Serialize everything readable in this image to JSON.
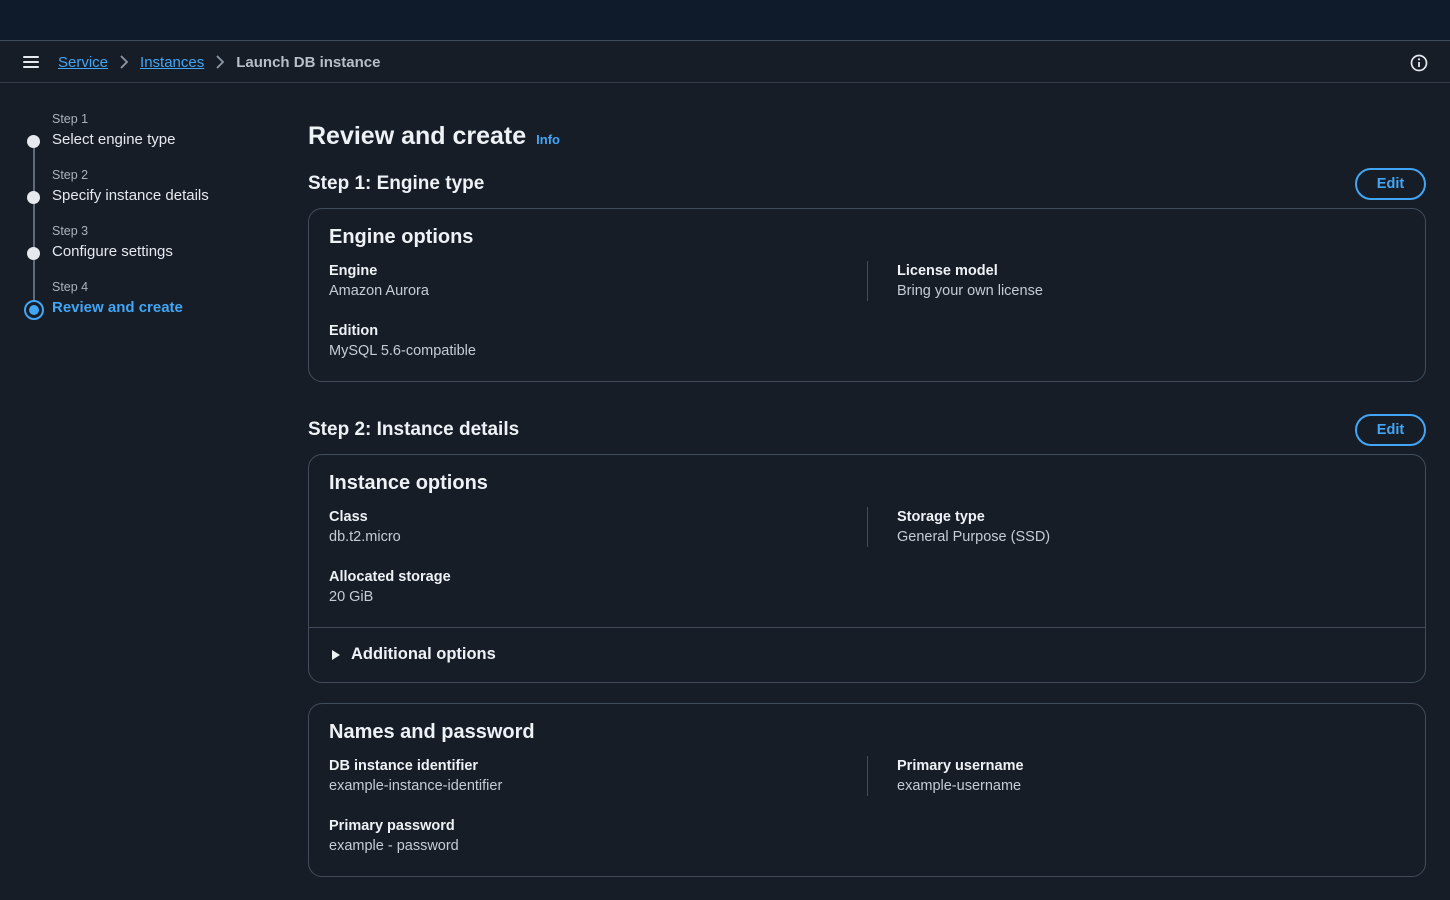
{
  "breadcrumb": {
    "items": [
      "Service",
      "Instances"
    ],
    "current": "Launch DB instance"
  },
  "steps": [
    {
      "num": "Step 1",
      "title": "Select engine type"
    },
    {
      "num": "Step 2",
      "title": "Specify instance details"
    },
    {
      "num": "Step 3",
      "title": "Configure settings"
    },
    {
      "num": "Step 4",
      "title": "Review and create"
    }
  ],
  "page": {
    "title": "Review and create",
    "info_label": "Info"
  },
  "section1": {
    "heading": "Step 1: Engine type",
    "edit_label": "Edit",
    "card": {
      "title": "Engine options",
      "engine": {
        "label": "Engine",
        "value": "Amazon Aurora"
      },
      "license": {
        "label": "License model",
        "value": "Bring your own license"
      },
      "edition": {
        "label": "Edition",
        "value": "MySQL 5.6-compatible"
      }
    }
  },
  "section2": {
    "heading": "Step 2: Instance details",
    "edit_label": "Edit",
    "instance_card": {
      "title": "Instance options",
      "class": {
        "label": "Class",
        "value": "db.t2.micro"
      },
      "storage_type": {
        "label": "Storage type",
        "value": "General Purpose (SSD)"
      },
      "allocated": {
        "label": "Allocated storage",
        "value": "20 GiB"
      },
      "additional": "Additional options"
    },
    "names_card": {
      "title": "Names and password",
      "identifier": {
        "label": "DB instance identifier",
        "value": "example-instance-identifier"
      },
      "username": {
        "label": "Primary username",
        "value": "example-username"
      },
      "password": {
        "label": "Primary password",
        "value": "example - password"
      }
    }
  },
  "icons": {
    "menu": "menu-icon",
    "breadcrumb_separator": "chevron-right-icon",
    "info": "info-icon",
    "expand": "caret-right-icon"
  },
  "colors": {
    "accent": "#42a5f5",
    "background": "#161d26",
    "topbar": "#0f1b2a",
    "border": "#414d5c"
  }
}
